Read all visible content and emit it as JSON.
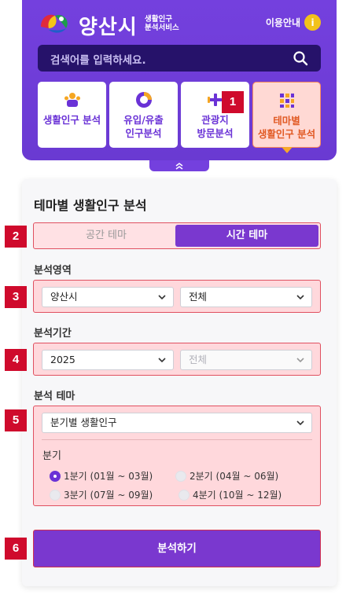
{
  "header": {
    "logo_title": "양산시",
    "logo_sub_line1": "생활인구",
    "logo_sub_line2": "분석서비스",
    "help_label": "이용안내",
    "help_icon_text": "i"
  },
  "search": {
    "placeholder": "검색어를 입력하세요."
  },
  "menu": {
    "tiles": [
      {
        "line1": "생활인구 분석",
        "line2": "",
        "icon": "people-icon"
      },
      {
        "line1": "유입/유출",
        "line2": "인구분석",
        "icon": "pie-chart-icon"
      },
      {
        "line1": "관광지",
        "line2": "방문분석",
        "icon": "airplane-icon"
      },
      {
        "line1": "테마별",
        "line2": "생활인구 분석",
        "icon": "grid-icon"
      }
    ],
    "collapse_icon": "chevron-up-icon"
  },
  "panel": {
    "title": "테마별 생활인구 분석",
    "tab_space": "공간 테마",
    "tab_time": "시간 테마",
    "area_label": "분석영역",
    "area_select1": "양산시",
    "area_select2": "전체",
    "period_label": "분석기간",
    "period_select1": "2025",
    "period_select2": "전체",
    "theme_label": "분석 테마",
    "theme_select": "분기별 생활인구",
    "quarter_label": "분기",
    "quarters": [
      "1분기 (01월 ~ 03월)",
      "2분기 (04월 ~ 06월)",
      "3분기 (07월 ~ 09월)",
      "4분기 (10월 ~ 12월)"
    ],
    "selected_quarter": 0,
    "analyze_button": "분석하기"
  },
  "badges": [
    "1",
    "2",
    "3",
    "4",
    "5",
    "6"
  ],
  "colors": {
    "primary": "#7440de",
    "button": "#7a38cf",
    "highlight_red": "#cf0a2c",
    "accent_orange": "#e15a24",
    "help_yellow": "#f2c21b"
  }
}
